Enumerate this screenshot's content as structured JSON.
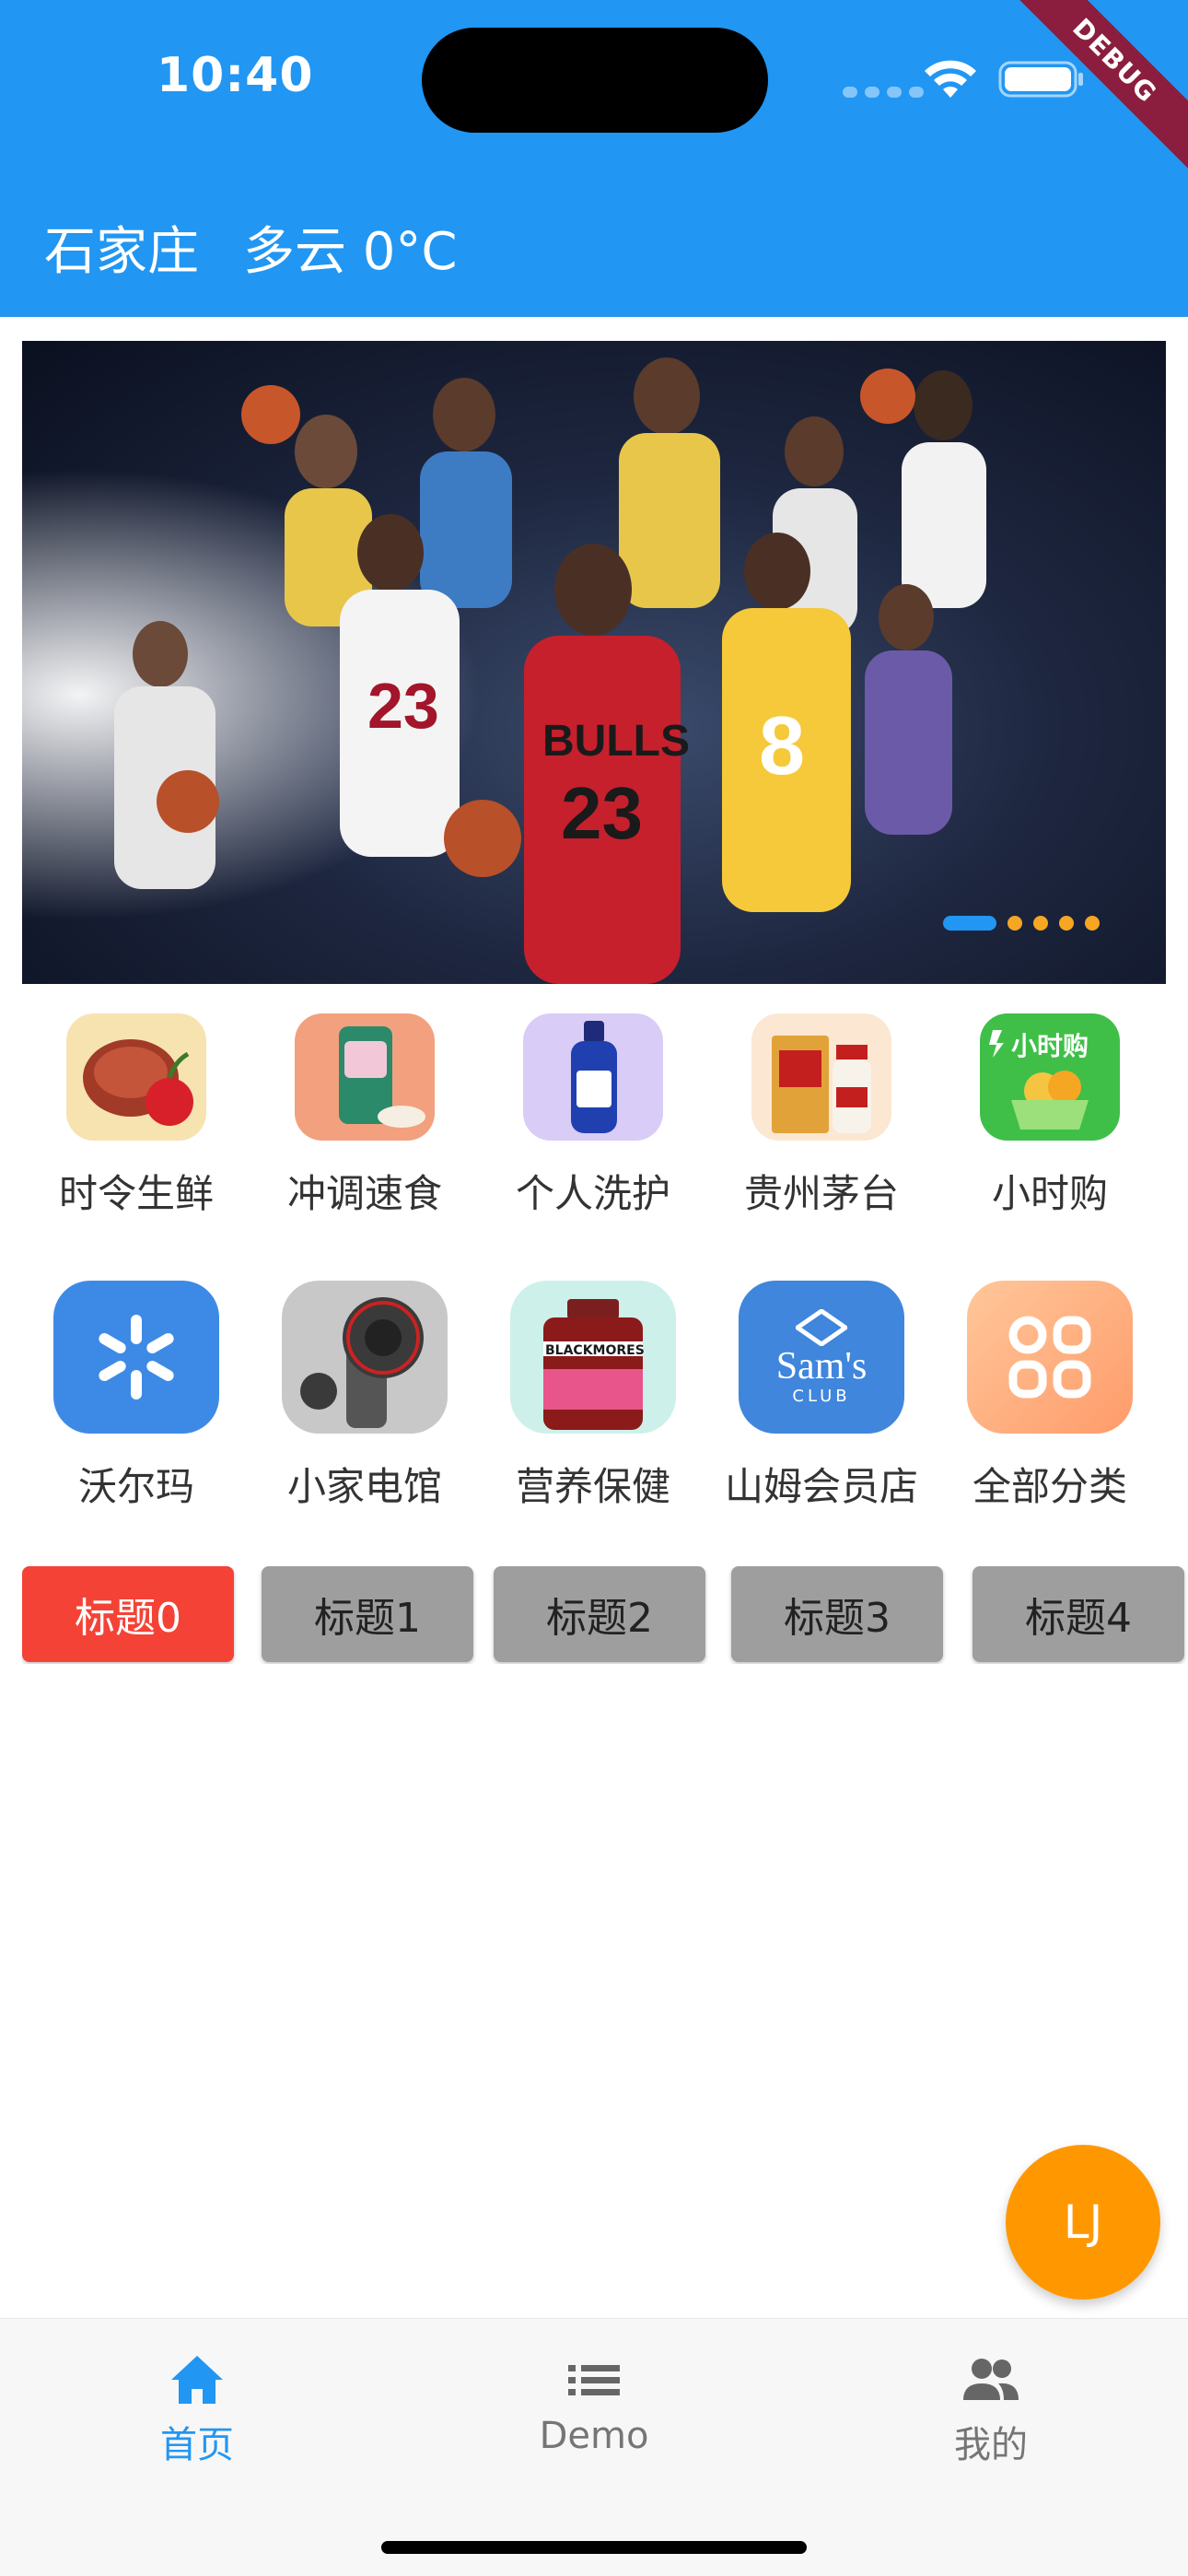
{
  "status_bar": {
    "time": "10:40"
  },
  "debug_banner": "DEBUG",
  "appbar": {
    "city": "石家庄",
    "weather": "多云 0°C"
  },
  "banner": {
    "slides": 5,
    "active_index": 0
  },
  "categories": [
    {
      "label": "时令生鲜",
      "icon": "steak-cherry-icon"
    },
    {
      "label": "冲调速食",
      "icon": "drink-can-icon"
    },
    {
      "label": "个人洗护",
      "icon": "shampoo-bottle-icon"
    },
    {
      "label": "贵州茅台",
      "icon": "moutai-liquor-icon"
    },
    {
      "label": "小时购",
      "icon": "hour-shopping-basket-icon",
      "badge": "小时购"
    },
    {
      "label": "沃尔玛",
      "icon": "walmart-spark-icon"
    },
    {
      "label": "小家电馆",
      "icon": "hair-dryer-icon"
    },
    {
      "label": "营养保健",
      "icon": "supplement-bottle-icon",
      "brand": "BLACKMORES"
    },
    {
      "label": "山姆会员店",
      "icon": "sams-club-icon",
      "brand_top": "Sam's",
      "brand_bottom": "CLUB"
    },
    {
      "label": "全部分类",
      "icon": "all-categories-icon"
    }
  ],
  "tabs": [
    "标题0",
    "标题1",
    "标题2",
    "标题3",
    "标题4"
  ],
  "active_tab": 0,
  "fab": {
    "label": "LJ"
  },
  "bottom_nav": [
    {
      "label": "首页",
      "icon": "home-icon",
      "active": true
    },
    {
      "label": "Demo",
      "icon": "list-icon",
      "active": false
    },
    {
      "label": "我的",
      "icon": "people-icon",
      "active": false
    }
  ],
  "colors": {
    "primary": "#2196F3",
    "tab_active": "#F44336",
    "tab_inactive": "#9E9E9E",
    "fab": "#FF9800",
    "banner_dot": "#F5A623"
  }
}
